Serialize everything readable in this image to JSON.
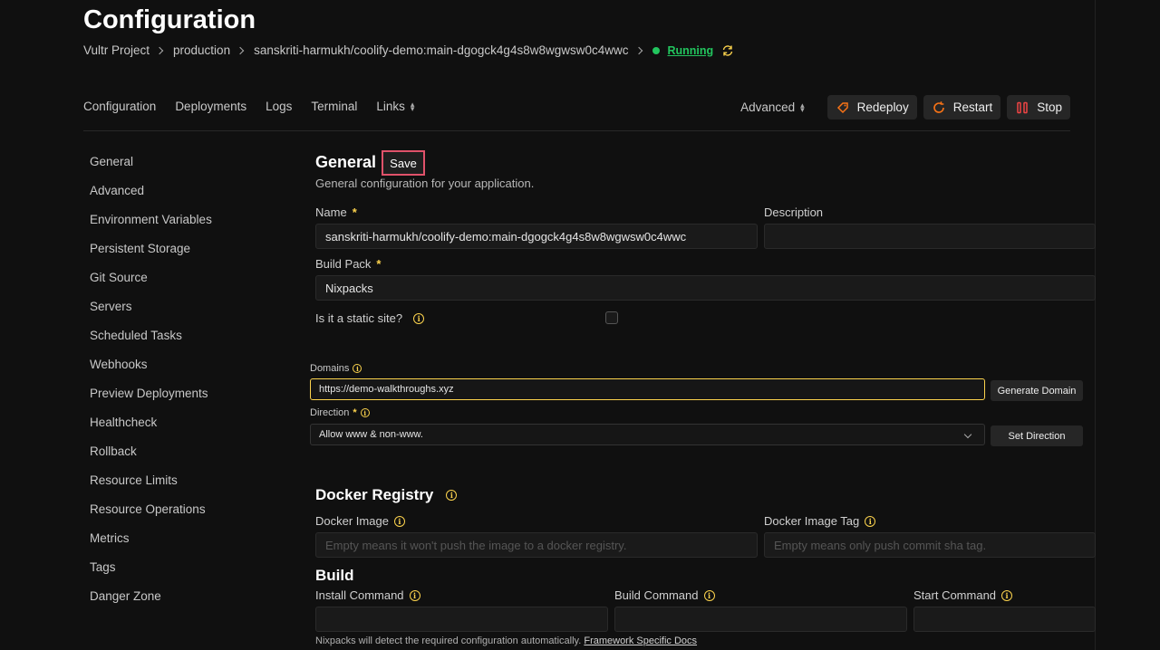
{
  "page": {
    "title": "Configuration",
    "breadcrumb": [
      "Vultr Project",
      "production",
      "sanskriti-harmukh/coolify-demo:main-dgogck4g4s8w8wgwsw0c4wwc"
    ],
    "status": "Running"
  },
  "nav": {
    "tabs": [
      "Configuration",
      "Deployments",
      "Logs",
      "Terminal",
      "Links"
    ],
    "advanced": "Advanced",
    "redeploy": "Redeploy",
    "restart": "Restart",
    "stop": "Stop"
  },
  "sidebar": {
    "items": [
      "General",
      "Advanced",
      "Environment Variables",
      "Persistent Storage",
      "Git Source",
      "Servers",
      "Scheduled Tasks",
      "Webhooks",
      "Preview Deployments",
      "Healthcheck",
      "Rollback",
      "Resource Limits",
      "Resource Operations",
      "Metrics",
      "Tags",
      "Danger Zone"
    ]
  },
  "general": {
    "heading": "General",
    "save_label": "Save",
    "subtitle": "General configuration for your application.",
    "name_label": "Name",
    "name_value": "sanskriti-harmukh/coolify-demo:main-dgogck4g4s8w8wgwsw0c4wwc",
    "description_label": "Description",
    "description_value": "",
    "buildpack_label": "Build Pack",
    "buildpack_value": "Nixpacks",
    "static_label": "Is it a static site?",
    "static_checked": false
  },
  "domains": {
    "label": "Domains",
    "value": "https://demo-walkthroughs.xyz",
    "generate_label": "Generate Domain",
    "direction_label": "Direction",
    "direction_value": "Allow www & non-www.",
    "set_direction_label": "Set Direction"
  },
  "docker": {
    "heading": "Docker Registry",
    "image_label": "Docker Image",
    "image_placeholder": "Empty means it won't push the image to a docker registry.",
    "tag_label": "Docker Image Tag",
    "tag_placeholder": "Empty means only push commit sha tag."
  },
  "build": {
    "heading": "Build",
    "install_label": "Install Command",
    "build_label": "Build Command",
    "start_label": "Start Command",
    "footer_text": "Nixpacks will detect the required configuration automatically.",
    "footer_link": "Framework Specific Docs"
  },
  "colors": {
    "accent": "#fcd34d",
    "running": "#22c55e",
    "highlight": "#e0526a"
  }
}
